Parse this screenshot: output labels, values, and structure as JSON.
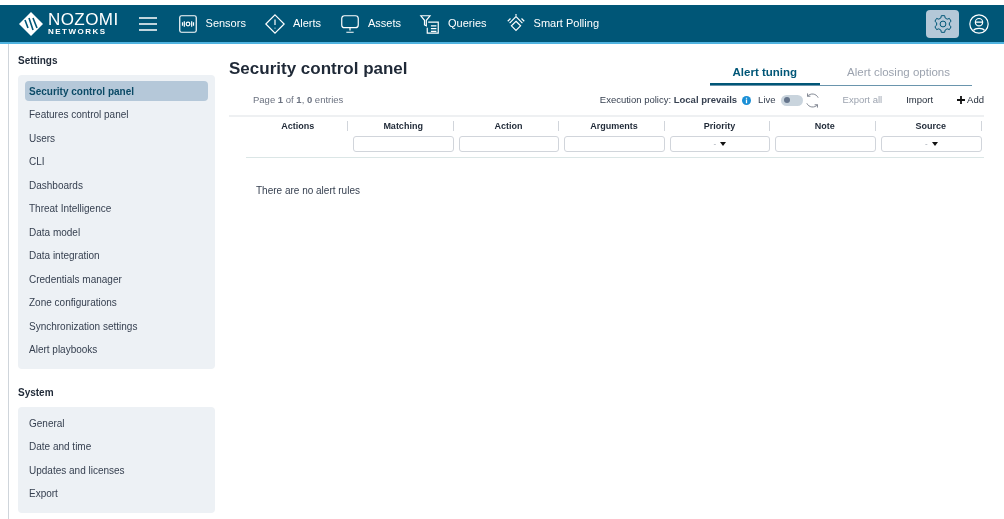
{
  "nav": {
    "logo_main": "NOZOMI",
    "logo_sub": "NETWORKS",
    "items": [
      {
        "label": "Sensors",
        "kind": "sensors"
      },
      {
        "label": "Alerts",
        "kind": "alerts"
      },
      {
        "label": "Assets",
        "kind": "assets"
      },
      {
        "label": "Queries",
        "kind": "queries"
      },
      {
        "label": "Smart Polling",
        "kind": "polling"
      }
    ],
    "settings_selected": true
  },
  "sidebar": {
    "sections": [
      {
        "title": "Settings",
        "items": [
          {
            "label": "Security control panel",
            "selected": true
          },
          {
            "label": "Features control panel",
            "selected": false
          },
          {
            "label": "Users",
            "selected": false
          },
          {
            "label": "CLI",
            "selected": false
          },
          {
            "label": "Dashboards",
            "selected": false
          },
          {
            "label": "Threat Intelligence",
            "selected": false
          },
          {
            "label": "Data model",
            "selected": false
          },
          {
            "label": "Data integration",
            "selected": false
          },
          {
            "label": "Credentials manager",
            "selected": false
          },
          {
            "label": "Zone configurations",
            "selected": false
          },
          {
            "label": "Synchronization settings",
            "selected": false
          },
          {
            "label": "Alert playbooks",
            "selected": false
          }
        ]
      },
      {
        "title": "System",
        "items": [
          {
            "label": "General",
            "selected": false
          },
          {
            "label": "Date and time",
            "selected": false
          },
          {
            "label": "Updates and licenses",
            "selected": false
          },
          {
            "label": "Export",
            "selected": false
          }
        ]
      }
    ]
  },
  "page": {
    "title": "Security control panel",
    "tabs": [
      {
        "label": "Alert tuning",
        "selected": true
      },
      {
        "label": "Alert closing options",
        "selected": false
      }
    ],
    "pagination": "Page **1** of **1**, **0** entries",
    "policy": "Execution policy: **Local prevails**",
    "live": {
      "label": "Live",
      "on": false
    },
    "actions": [
      {
        "label": "Export all",
        "disabled": true,
        "kind": "text"
      },
      {
        "label": "Import",
        "disabled": false,
        "kind": "text"
      },
      {
        "label": "Add",
        "disabled": false,
        "kind": "add"
      }
    ],
    "table": {
      "columns": [
        {
          "label": "Actions",
          "kind": "plain"
        },
        {
          "label": "Matching",
          "kind": "text"
        },
        {
          "label": "Action",
          "kind": "text"
        },
        {
          "label": "Arguments",
          "kind": "text"
        },
        {
          "label": "Priority",
          "kind": "select",
          "value": "-"
        },
        {
          "label": "Note",
          "kind": "text"
        },
        {
          "label": "Source",
          "kind": "select",
          "value": "-"
        }
      ],
      "empty_message": "There are no alert rules"
    }
  }
}
